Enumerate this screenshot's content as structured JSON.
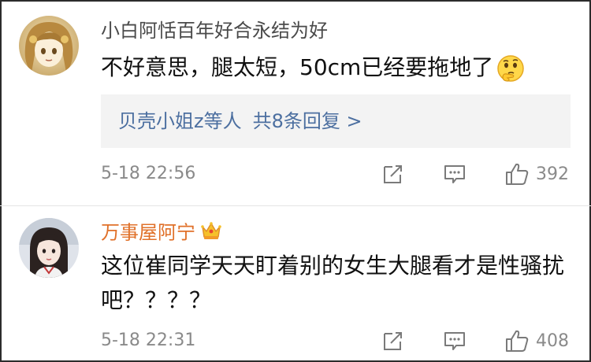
{
  "comments": [
    {
      "username": "小白阿恬百年好合永结为好",
      "text": "不好意思，腿太短，50cm已经要拖地了",
      "emoji": "thinking-face-emoji",
      "replies": {
        "users": "贝壳小姐z等人",
        "count": "共8条回复 >"
      },
      "time": "5-18 22:56",
      "likes": "392"
    },
    {
      "username": "万事屋阿宁",
      "badge": "crown-icon",
      "text": "这位崔同学天天盯着别的女生大腿看才是性骚扰吧？？？？",
      "time": "5-18 22:31",
      "likes": "408"
    }
  ],
  "colors": {
    "username_default": "#4a4a4a",
    "username_vip": "#e0712a",
    "link": "#4c6fa0",
    "meta": "#8a8a8a"
  }
}
